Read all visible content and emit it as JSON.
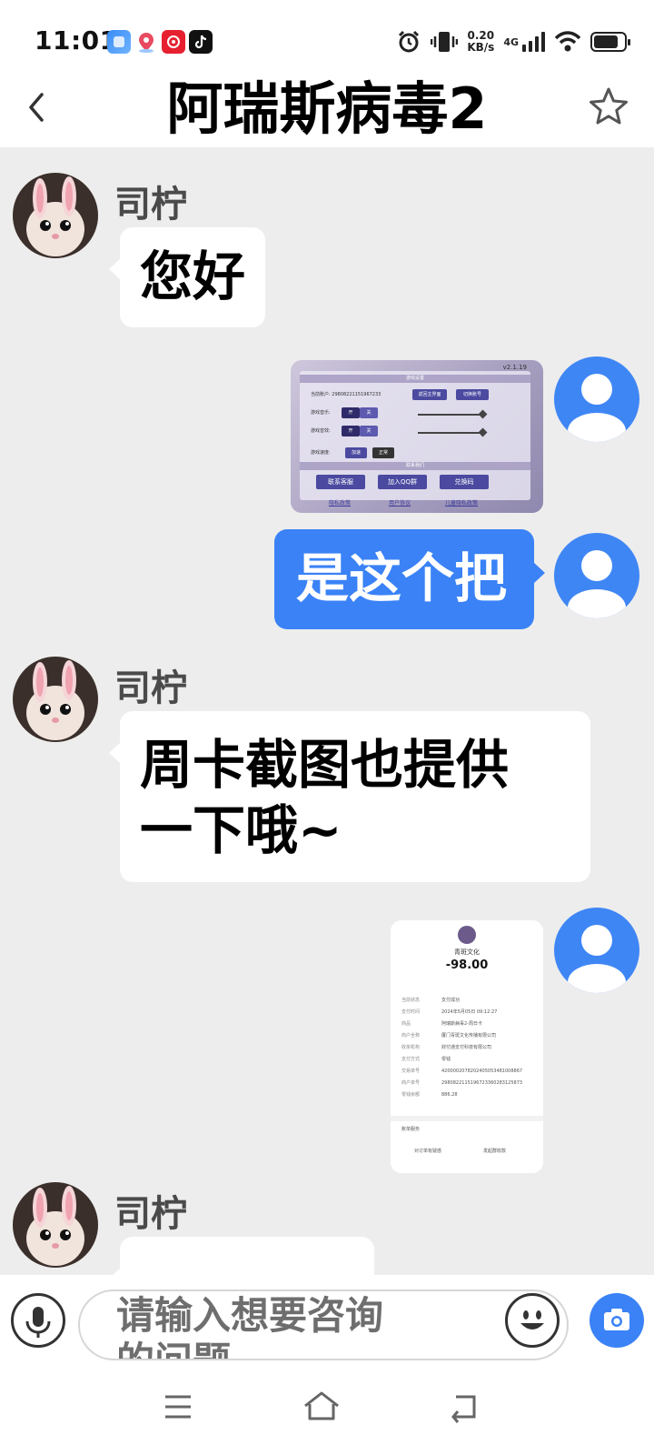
{
  "status_bar": {
    "time": "11:01",
    "app_icons": [
      "app-notification-icon",
      "map-pin-icon",
      "red-app-icon",
      "tiktok-icon"
    ],
    "right_icons": [
      "alarm-icon",
      "vibrate-icon"
    ],
    "net_speed_value": "0.20",
    "net_speed_unit": "KB/s",
    "network_type": "4G",
    "battery_level": 0.8
  },
  "header": {
    "title": "阿瑞斯病毒2",
    "back_icon": "chevron-left-icon",
    "favorite_icon": "star-outline-icon"
  },
  "messages": [
    {
      "type": "text",
      "side": "left",
      "sender": "司柠",
      "text": "您好"
    },
    {
      "type": "image",
      "side": "right",
      "image": {
        "version": "v2.1.19",
        "section_title": "游戏设置",
        "account_label": "当前账户: 29808221151967233",
        "btn_back_main": "返回主界面",
        "btn_switch_account": "切换账号",
        "music_label": "游戏音乐:",
        "sound_label": "游戏音效:",
        "toggle_on": "开",
        "toggle_off": "关",
        "speed_label": "游戏速度:",
        "speed_fast": "加速",
        "speed_normal": "正常",
        "contact_section": "联系我们",
        "btn_service": "联系客服",
        "btn_qq": "加入QQ群",
        "btn_redeem": "兑换码",
        "link_privacy": "隐私政策",
        "link_agreement": "用户协议",
        "link_child": "儿童隐私政策"
      }
    },
    {
      "type": "text",
      "side": "right",
      "text": "是这个把"
    },
    {
      "type": "text",
      "side": "left",
      "sender": "司柠",
      "text_line1": "周卡截图也提供",
      "text_line2": "一下哦~"
    },
    {
      "type": "image",
      "side": "right",
      "receipt": {
        "merchant": "青斑文化",
        "amount": "-98.00",
        "rows": [
          {
            "k": "当前状态",
            "v": "支付成功"
          },
          {
            "k": "支付时间",
            "v": "2024年5月05日 09:12:27"
          },
          {
            "k": "商品",
            "v": "阿瑞斯病毒2-周日卡"
          },
          {
            "k": "商户全称",
            "v": "厦门青斑文化传播有限公司"
          },
          {
            "k": "收单机构",
            "v": "财付通支付科技有限公司"
          },
          {
            "k": "支付方式",
            "v": "零钱"
          },
          {
            "k": "交易单号",
            "v": "4200002078202405053481008867"
          },
          {
            "k": "商户单号",
            "v": "2980822115196723360283125873"
          },
          {
            "k": "零钱余额",
            "v": "886.28"
          }
        ],
        "section_label": "账单服务",
        "footer_left": "对订单有疑惑",
        "footer_right": "发起群收款"
      }
    },
    {
      "type": "text",
      "side": "left",
      "sender": "司柠",
      "text": ""
    }
  ],
  "input_bar": {
    "placeholder_line1": "请输入想要咨询",
    "placeholder_line2": "的问题",
    "mic_icon": "microphone-icon",
    "emoji_icon": "smile-emoji-icon",
    "camera_icon": "camera-icon"
  },
  "nav_bar": {
    "icons": [
      "menu-icon",
      "home-icon",
      "back-icon"
    ]
  },
  "colors": {
    "accent_blue": "#3a82f6",
    "chat_background": "#ededed",
    "bubble_in": "#ffffff"
  }
}
